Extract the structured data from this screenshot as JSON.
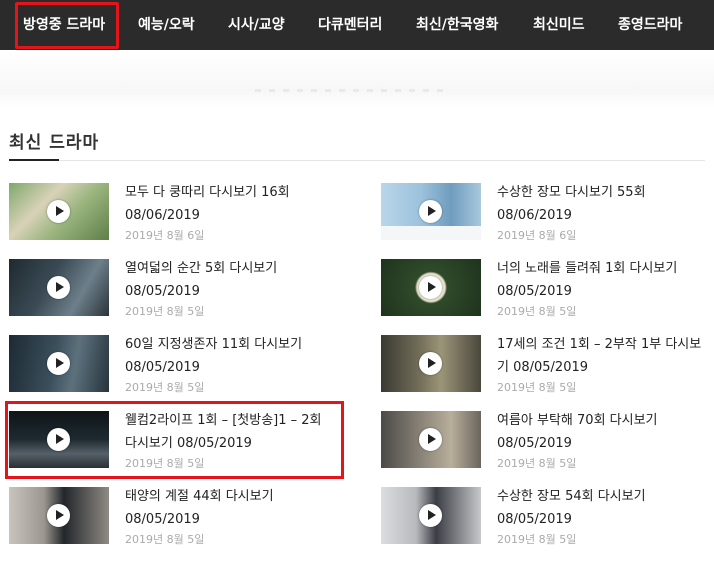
{
  "nav": {
    "items": [
      "방영중 드라마",
      "예능/오락",
      "시사/교양",
      "다큐멘터리",
      "최신/한국영화",
      "최신미드",
      "종영드라마"
    ]
  },
  "section": {
    "title": "최신 드라마"
  },
  "posts": [
    {
      "title": "모두 다 쿵따리 다시보기 16회 08/06/2019",
      "date": "2019년 8월 6일"
    },
    {
      "title": "수상한 장모 다시보기 55회 08/06/2019",
      "date": "2019년 8월 6일"
    },
    {
      "title": "열여덟의 순간 5회 다시보기 08/05/2019",
      "date": "2019년 8월 5일"
    },
    {
      "title": "너의 노래를 들려줘 1회 다시보기 08/05/2019",
      "date": "2019년 8월 5일"
    },
    {
      "title": "60일 지정생존자 11회 다시보기 08/05/2019",
      "date": "2019년 8월 5일"
    },
    {
      "title": "17세의 조건 1회 – 2부작 1부 다시보기 08/05/2019",
      "date": "2019년 8월 5일"
    },
    {
      "title": "웰컴2라이프 1회 – [첫방송]1 – 2회 다시보기 08/05/2019",
      "date": "2019년 8월 5일"
    },
    {
      "title": "여름아 부탁해 70회 다시보기 08/05/2019",
      "date": "2019년 8월 5일"
    },
    {
      "title": "태양의 계절 44회 다시보기 08/05/2019",
      "date": "2019년 8월 5일"
    },
    {
      "title": "수상한 장모 54회 다시보기 08/05/2019",
      "date": "2019년 8월 5일"
    }
  ],
  "colors": {
    "nav_bg": "#2b2b2b",
    "highlight": "#e4141b",
    "date_text": "#aaaaaa"
  }
}
